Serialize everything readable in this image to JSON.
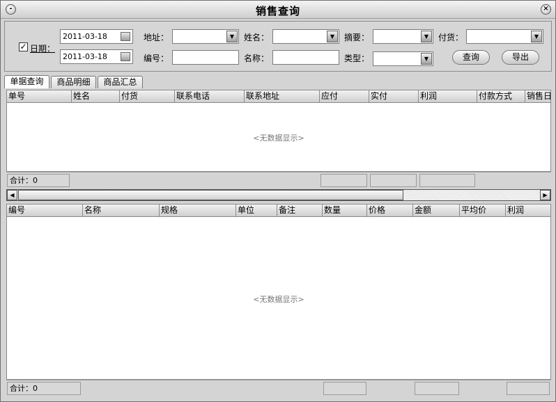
{
  "window": {
    "title": "销售查询"
  },
  "filter": {
    "date_label": "日期：",
    "date_enabled": true,
    "date_from": "2011-03-18",
    "date_to": "2011-03-18",
    "address_label": "地址：",
    "code_label": "编号：",
    "name_label": "姓名：",
    "title_label": "名称：",
    "summary_label": "摘要：",
    "type_label": "类型：",
    "payment_label": "付货：",
    "query_button": "查询",
    "export_button": "导出"
  },
  "tabs": [
    "单据查询",
    "商品明细",
    "商品汇总"
  ],
  "orders_grid": {
    "columns": [
      "单号",
      "姓名",
      "付货",
      "联系电话",
      "联系地址",
      "应付",
      "实付",
      "利润",
      "付款方式",
      "销售日"
    ],
    "empty_text": "<无数据显示>",
    "total_label": "合计：0"
  },
  "items_grid": {
    "columns": [
      "编号",
      "名称",
      "规格",
      "单位",
      "备注",
      "数量",
      "价格",
      "金额",
      "平均价",
      "利润"
    ],
    "empty_text": "<无数据显示>",
    "total_label": "合计：0"
  },
  "icons": {
    "menu": "circle-menu-icon",
    "close": "close-icon",
    "dropdown": "triangle-down-icon",
    "scroll_left": "triangle-left-icon",
    "scroll_right": "triangle-right-icon",
    "calendar": "calendar-icon"
  },
  "colors": {
    "window_bg": "#d4d4d4",
    "grid_bg": "#ffffff",
    "empty_text": "#777777"
  }
}
